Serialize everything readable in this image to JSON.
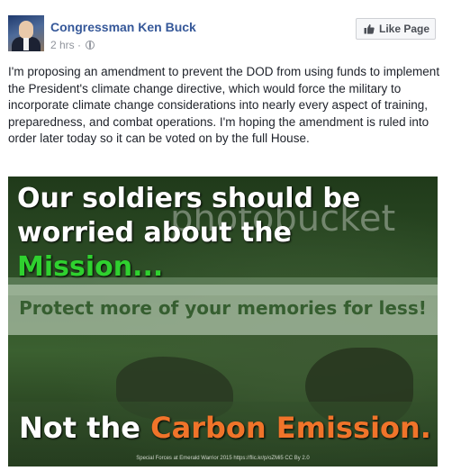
{
  "post": {
    "page_name": "Congressman Ken Buck",
    "time": "2 hrs",
    "separator": "·",
    "privacy_icon": "globe-icon",
    "like_button_label": "Like Page",
    "like_icon": "thumbs-up-icon",
    "text": "I'm proposing an amendment to prevent the DOD from using funds to implement the President's climate change directive, which would force the military to incorporate climate change considerations into nearly every aspect of training, preparedness, and combat operations. I'm hoping the amendment is ruled into order later today so it can be voted on by the full House."
  },
  "image": {
    "headline_line1": "Our soldiers should be",
    "headline_line2": "worried about the",
    "headline_line3": "Mission...",
    "bottom_prefix": "Not the ",
    "bottom_highlight": "Carbon Emission.",
    "watermark_brand": "photobucket",
    "watermark_text": "Protect more of your memories for less!",
    "credit": "Special Forces at Emerald Warrior 2015 https://flic.kr/p/oZMi5 CC By 2.0",
    "colors": {
      "mission": "#2fd12f",
      "carbon": "#f0742a",
      "link": "#365899"
    }
  }
}
